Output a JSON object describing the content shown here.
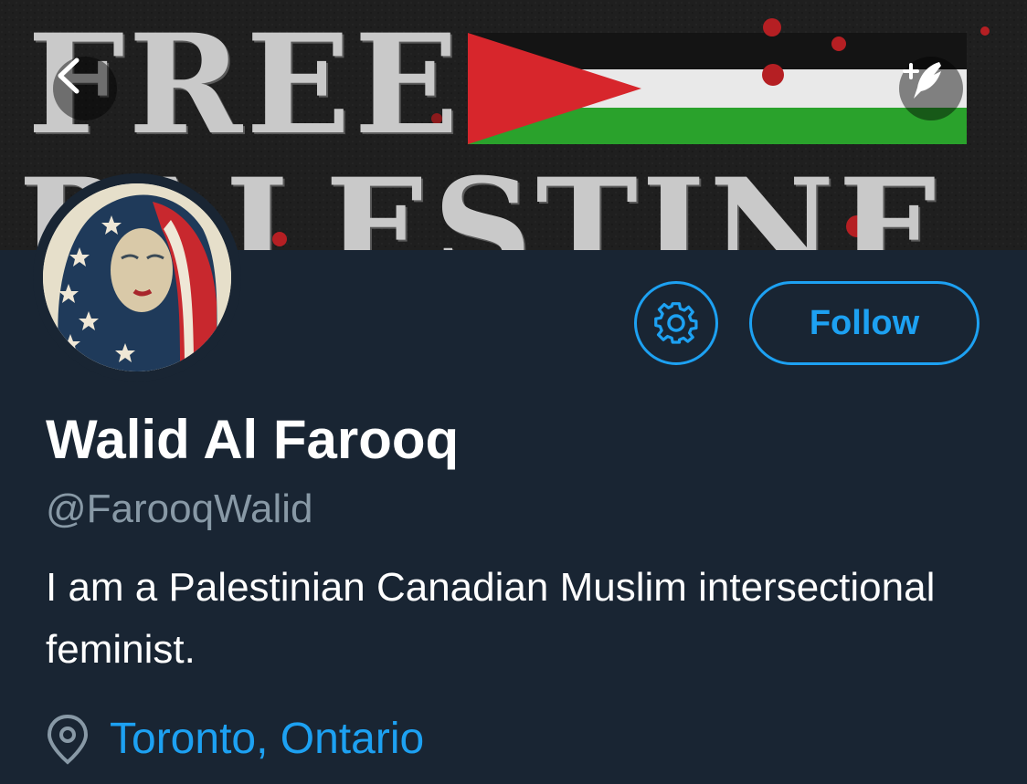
{
  "banner": {
    "line1": "FREE",
    "line2": "PALESTINE"
  },
  "icons": {
    "back": "chevron-left-icon",
    "compose": "compose-quill-icon",
    "settings": "gear-icon",
    "location": "location-pin-icon"
  },
  "colors": {
    "accent": "#1da1f2",
    "background": "#192533",
    "secondary_text": "#8899a6"
  },
  "actions": {
    "follow_label": "Follow"
  },
  "profile": {
    "display_name": "Walid Al Farooq",
    "handle": "@FarooqWalid",
    "bio": "I am a Palestinian Canadian Muslim intersectional feminist.",
    "location": "Toronto, Ontario"
  }
}
